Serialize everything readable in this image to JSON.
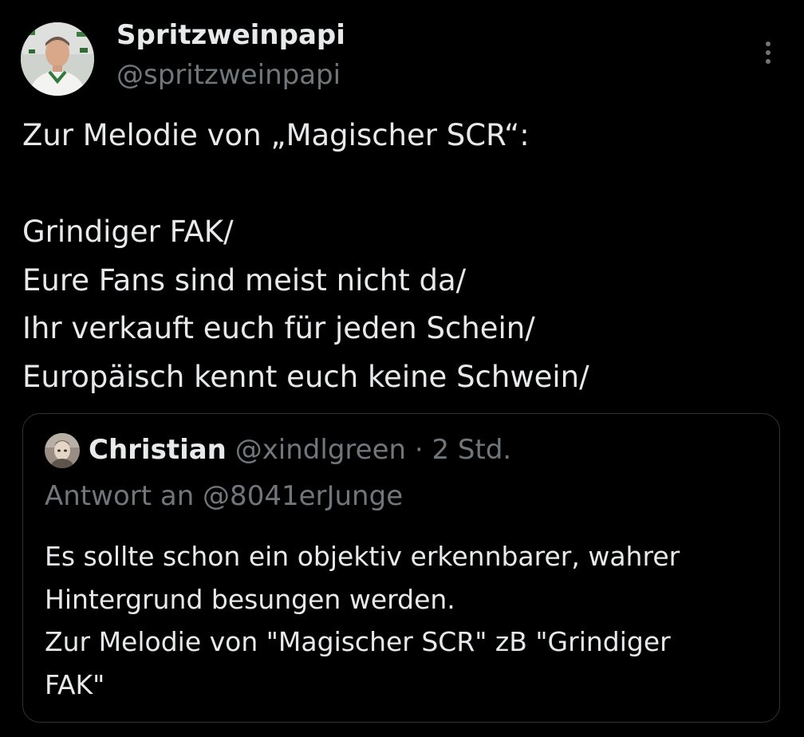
{
  "tweet": {
    "author": {
      "display_name": "Spritzweinpapi",
      "handle": "@spritzweinpapi",
      "avatar_icon": "profile-photo"
    },
    "more_icon": "more-vertical-icon",
    "lines": [
      "Zur Melodie von „Magischer SCR“:",
      "",
      "Grindiger FAK/",
      "Eure Fans sind meist nicht da/",
      "Ihr verkauft euch für jeden Schein/",
      "Europäisch kennt euch keine Schwein/"
    ]
  },
  "quote": {
    "author": {
      "display_name": "Christian",
      "handle": "@xindlgreen",
      "avatar_icon": "profile-photo"
    },
    "separator": "·",
    "timestamp": "2 Std.",
    "reply_to": "Antwort an @8041erJunge",
    "lines": [
      "Es sollte schon ein objektiv erkennbarer, wahrer",
      "Hintergrund besungen werden.",
      "Zur Melodie von \"Magischer SCR\" zB \"Grindiger",
      "FAK\""
    ]
  },
  "colors": {
    "background": "#000000",
    "text_primary": "#e7e9ea",
    "text_secondary": "#71767b",
    "border": "#2f3336"
  }
}
